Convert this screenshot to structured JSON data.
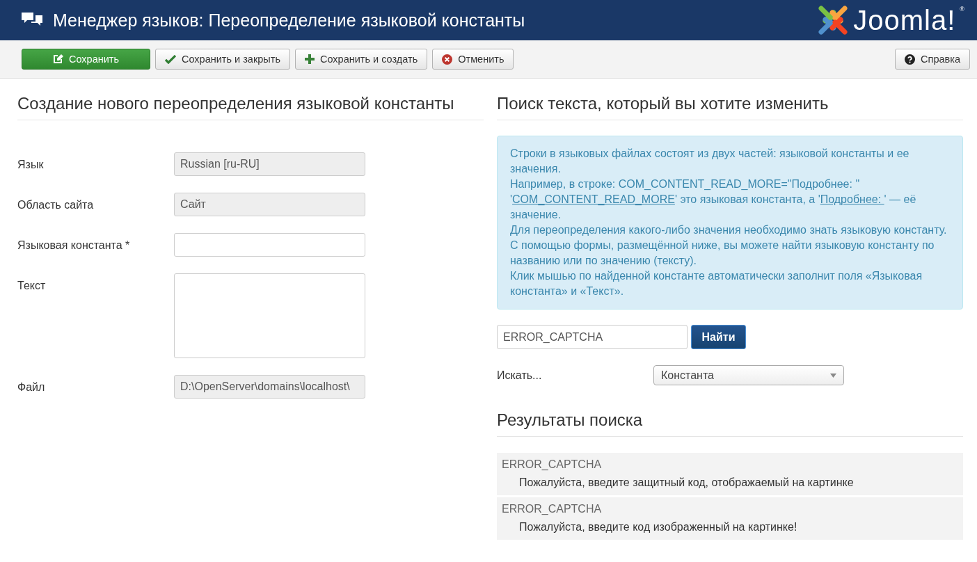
{
  "header": {
    "title": "Менеджер языков: Переопределение языковой константы",
    "logo_text": "Joomla!",
    "logo_mark": "®"
  },
  "toolbar": {
    "buttons": [
      {
        "label": "Сохранить",
        "kind": "save"
      },
      {
        "label": "Сохранить и закрыть",
        "kind": "save-close"
      },
      {
        "label": "Сохранить и создать",
        "kind": "save-new"
      },
      {
        "label": "Отменить",
        "kind": "cancel"
      }
    ],
    "help_button": {
      "label": "Справка",
      "kind": "help"
    }
  },
  "form": {
    "heading": "Создание нового переопределения языковой константы",
    "fields": [
      {
        "label": "Язык",
        "kind": "readonly",
        "value": "Russian [ru-RU]"
      },
      {
        "label": "Область сайта",
        "kind": "readonly",
        "value": "Сайт"
      },
      {
        "label": "Языковая константа *",
        "kind": "text"
      },
      {
        "label": "Текст",
        "kind": "textarea"
      },
      {
        "label": "Файл",
        "kind": "readonly",
        "value": "D:\\OpenServer\\domains\\localhost\\"
      }
    ]
  },
  "search": {
    "heading": "Поиск текста, который вы хотите изменить",
    "info": [
      [
        {
          "text": "Строки в языковых файлах состоят из двух частей: языковой константы и ее значения."
        }
      ],
      [
        {
          "text": "Например, в строке: COM_CONTENT_READ_MORE=\"Подробнее: \" '"
        },
        {
          "text": "COM_CONTENT_READ_MORE",
          "kind": "link"
        },
        {
          "text": "' это языковая константа, а '"
        },
        {
          "text": "Подробнее: ",
          "kind": "link"
        },
        {
          "text": "' — её значение."
        }
      ],
      [
        {
          "text": "Для переопределения какого-либо значения необходимо знать языковую константу. С помощью формы, размещённой ниже, вы можете найти языковую константу по названию или по значению (тексту)."
        }
      ],
      [
        {
          "text": "Клик мышью по найденной константе автоматически заполнит поля «Языковая константа» и «Текст»."
        }
      ]
    ],
    "query": "ERROR_CAPTCHA",
    "find_button": "Найти",
    "search_in_label": "Искать...",
    "search_in_value": "Константа",
    "results_heading": "Результаты поиска",
    "results": [
      {
        "constant": "ERROR_CAPTCHA",
        "text": "Пожалуйста, введите защитный код, отображаемый на картинке"
      },
      {
        "constant": "ERROR_CAPTCHA",
        "text": "Пожалуйста, введите код изображенный на картинке!"
      }
    ]
  }
}
